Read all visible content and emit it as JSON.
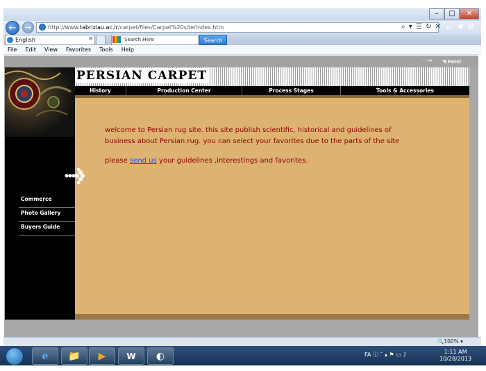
{
  "browser": {
    "url_prefix": "http://www.",
    "url_host": "tabriziau.ac.ir",
    "url_path": "/carpet/files/Carpet%20site/index.htm",
    "url_tools": "⌕ ▾ ☰ ↻ ✕",
    "tab_label": "English",
    "tab_close": "×",
    "search_placeholder": "Search Here",
    "search_button": "Search",
    "back": "←",
    "forward": "→",
    "home": "⌂",
    "favorites": "★",
    "settings": "⚙",
    "window": {
      "minimize": "–",
      "maximize": "□",
      "close": "✕"
    },
    "menu": [
      "File",
      "Edit",
      "View",
      "Favorites",
      "Tools",
      "Help"
    ],
    "zoom": "🔍100% ▾"
  },
  "page": {
    "top_links": {
      "arrow": "··→",
      "farsi": "◥ Farsi"
    },
    "site_title": "PERSIAN CARPET",
    "nav": [
      "History",
      "Production Center",
      "Process Stages",
      "Tools & Accessories"
    ],
    "intro_text": "welcome to Persian rug site. this site publish scientific, historical and guidelines of business about Persian rug. you can select your favorites due to the parts of the site",
    "please": "please",
    "send_us": "send us",
    "guidelines": "your guidelines ,interestings and favorites.",
    "side_menu": [
      "Commerce",
      "Photo Gallery",
      "Buyers Guide"
    ]
  },
  "taskbar": {
    "tray": "FA ⓘ ˇ ▴ ⚑ ▭ ♪",
    "time": "1:11 AM",
    "date": "10/28/2013",
    "apps": [
      "e",
      "📁",
      "▶",
      "W",
      "◐"
    ]
  },
  "colors": {
    "main_bg": "#deb271",
    "text_red": "#8b0000",
    "nav_bg": "#000000",
    "link": "#2255cc"
  }
}
